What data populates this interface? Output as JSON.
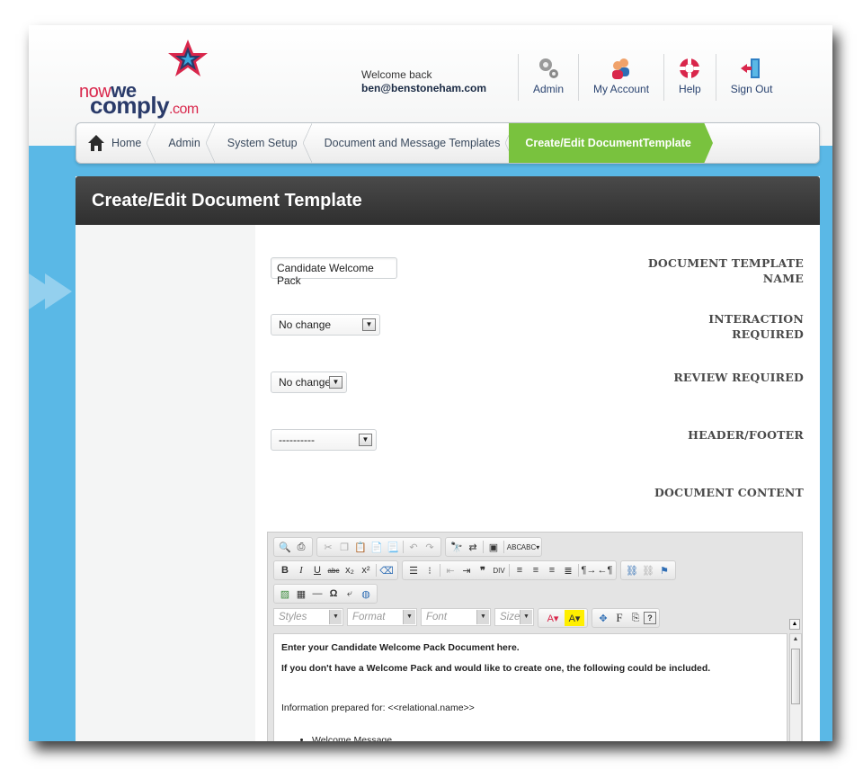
{
  "logo": {
    "part1": "now",
    "part2": "we",
    "part3": "comply",
    "part4": ".com"
  },
  "welcome": {
    "line1": "Welcome back",
    "user": "ben@benstoneham.com"
  },
  "nav": [
    {
      "label": "Admin",
      "icon": "gears-icon"
    },
    {
      "label": "My Account",
      "icon": "users-icon"
    },
    {
      "label": "Help",
      "icon": "lifebuoy-icon"
    },
    {
      "label": "Sign Out",
      "icon": "exit-door-icon"
    }
  ],
  "breadcrumb": [
    "Home",
    "Admin",
    "System Setup",
    "Document and Message Templates",
    "Create/Edit DocumentTemplate"
  ],
  "panel": {
    "title": "Create/Edit Document Template"
  },
  "form": {
    "template_name_label": "DOCUMENT TEMPLATE NAME",
    "template_name_value": "Candidate Welcome Pack",
    "interaction_label": "INTERACTION REQUIRED",
    "interaction_value": "No change",
    "review_label": "REVIEW REQUIRED",
    "review_value": "No change",
    "headerfooter_label": "HEADER/FOOTER",
    "headerfooter_value": "----------",
    "content_label": "DOCUMENT CONTENT"
  },
  "editor": {
    "combos": [
      "Styles",
      "Format",
      "Font",
      "Size"
    ],
    "content": {
      "line1": "Enter your Candidate Welcome Pack Document here.",
      "line2": "If you don't have a Welcome Pack and would like to create one, the following could be included.",
      "line3": "Information prepared for: <<relational.name>>",
      "bullet1": "Welcome Message"
    }
  },
  "colors": {
    "accent": "#79c23e",
    "background": "#5ab8e6",
    "title_bar": "#3a3a3a",
    "brand_red": "#d9264b",
    "brand_navy": "#2a3b6a"
  }
}
